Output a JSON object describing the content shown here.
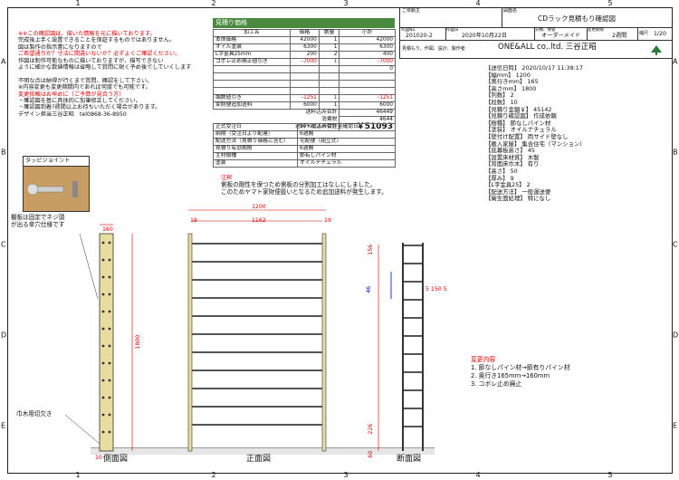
{
  "ruler": {
    "top": [
      "1",
      "2",
      "3",
      "4",
      "5"
    ],
    "side": [
      "A",
      "B",
      "C",
      "D",
      "E"
    ]
  },
  "title_block": {
    "client_label": "ご依頼主",
    "drawing_name_label": "図面名",
    "drawing_name": "CDラック見積もり確認図",
    "author_label": "作図No.",
    "doc_no": "201020-2",
    "date_label": "作図日",
    "date": "2020年10月22日",
    "category_label": "分類、保管",
    "category": "オーダーメイド",
    "delivery_label": "変更期限",
    "delivery": "2週間",
    "scale_label": "縮尺",
    "scale": "1/20",
    "maker_label": "見積もり、作図、設計、製作者",
    "maker": "ONE&ALL co,.ltd. 三谷正昭"
  },
  "notice_lines": [
    {
      "t": "※※この確認図は、描いた情報を元に描いております。",
      "c": "red"
    },
    {
      "t": "完成後上手く設置できることを保証するものではありません。",
      "c": ""
    },
    {
      "t": "図は製作の指示書になりますので",
      "c": ""
    },
    {
      "t": "ご希望通りか？寸法に間違いないか？必ずよくご確認ください。",
      "c": "red"
    },
    {
      "t": "作図は制作可能なものに描いておりますが、描写できない",
      "c": ""
    },
    {
      "t": "ように細かな数値情報は省略して質問に鋭く予め後でしていくします",
      "c": ""
    },
    {
      "t": "",
      "c": ""
    },
    {
      "t": "不明な点は納得が行くまで質問、確認をして下さい。",
      "c": ""
    },
    {
      "t": "※内容変更も変更期間内であれば何度でも可能です。",
      "c": ""
    },
    {
      "t": "変更依頼はお早めに（ご予算が見合う方）",
      "c": "red"
    },
    {
      "t": "・確認図を基に具体的に加筆修正してください。",
      "c": ""
    },
    {
      "t": "・確認図到着?週間以上お待ちいただく場合があります。",
      "c": ""
    },
    {
      "t": "デザイン担当三谷正昭　tel0868-36-8950",
      "c": ""
    }
  ],
  "tappy": {
    "label": "タッピジョイント"
  },
  "side_notes": {
    "fixed": "棚板は固定でネジ頭\nが出る傘穴仕様です",
    "cutout": "巾木用切欠き"
  },
  "estimate": {
    "header": "見積り価格",
    "cols": [
      "加工名",
      "価格",
      "数量",
      "小計"
    ],
    "rows": [
      {
        "name": "本体価格",
        "price": "42000",
        "qty": "1",
        "sub": "42000",
        "red": false
      },
      {
        "name": "オイル塗装",
        "price": "6300",
        "qty": "1",
        "sub": "6300",
        "red": false
      },
      {
        "name": "L字金具25mm",
        "price": "200",
        "qty": "2",
        "sub": "400",
        "red": false
      },
      {
        "name": "コボレ止め廃止値引き",
        "price": "-7000",
        "qty": "1",
        "sub": "-7000",
        "red": true
      },
      {
        "name": "",
        "price": "",
        "qty": "",
        "sub": "0",
        "red": false
      },
      {
        "name": "",
        "price": "",
        "qty": "",
        "sub": "",
        "red": false
      },
      {
        "name": "",
        "price": "",
        "qty": "",
        "sub": "",
        "red": false
      },
      {
        "name": "",
        "price": "",
        "qty": "",
        "sub": "",
        "red": false
      },
      {
        "name": "端数値引き",
        "price": "-1251",
        "qty": "1",
        "sub": "-1251",
        "red": true
      },
      {
        "name": "家財便追加送料",
        "price": "6000",
        "qty": "1",
        "sub": "6000",
        "red": false
      }
    ],
    "subtotal_label": "送料込み合計",
    "subtotal": "46449",
    "tax_label": "消費税",
    "tax": "4644",
    "total_label": "送料・税込み合計",
    "total": "￥51093",
    "info": [
      [
        "正式受注日",
        "50%以上の受注金確認日"
      ],
      [
        "納期（受注日より配達）",
        "6週間"
      ],
      [
        "配送方法（見積り価格に含む）",
        "宅配便（組立式）"
      ],
      [
        "見積り有効期限",
        "6週間"
      ],
      [
        "主材樹種",
        "節有しパイン材"
      ],
      [
        "塗装",
        "オイルナチュラル"
      ]
    ]
  },
  "caution": {
    "title": "注釈",
    "lines": [
      "側板の剛性を保つため側板の分割加工はなしにしました。",
      "このためヤマト家財便扱いとなるため追加送料が発生します。"
    ]
  },
  "spec": [
    "【送信日時】 2020/10/17 11:38:17",
    "【幅mm】 1200",
    "【奥行きmm】 165",
    "【高さmm】 1800",
    "【列数】 2",
    "【段数】 10",
    "【見積り金額￥】 45142",
    "【見積り確認図】 作成依頼",
    "【樹種】 節なしパイン材",
    "【塗装】 オイルナチュラル",
    "【壁付け配置】 両サイド壁なし",
    "【搬入家屋】 集合住宅（マンション）",
    "【底幕板高さ】 45",
    "【設置床材質】 木製",
    "【背面床巾木】 有り",
    "【高さ】 50",
    "【厚み】 9",
    "【L字金具25】 2",
    "【配送方法】 一般運送便",
    "【衛生面処理】 特になし"
  ],
  "changes": {
    "title": "変更内容",
    "items": [
      "1. 節なしパイン材→節有りパイン材",
      "2. 奥行き165mm→160mm",
      "3. コボレ止め廃止"
    ]
  },
  "dims": {
    "front_width": "1200",
    "front_inner": "1162",
    "front_side_l": "19",
    "front_side_r": "19",
    "side_depth": "160",
    "side_height": "1800",
    "side_bottom": "10",
    "sec_top": "156",
    "sec_pitch": "146",
    "sec_bot": "226",
    "sec_base": "60",
    "sec_w": "5 150 5",
    "sec_kick": "46",
    "sec_small": "19"
  },
  "view_labels": {
    "side": "側面図",
    "front": "正面図",
    "section": "断面図"
  }
}
